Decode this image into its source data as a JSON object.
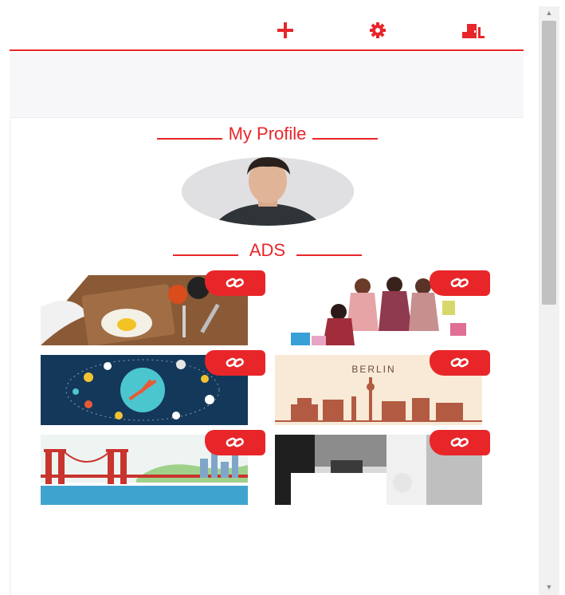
{
  "toolbar": {
    "icons": [
      "plus-icon",
      "gear-icon",
      "logout-door-icon"
    ]
  },
  "profile": {
    "title": "My Profile"
  },
  "ads": {
    "title": "ADS",
    "items": [
      {
        "image": "food-breakfast-photo"
      },
      {
        "image": "shopping-women-photo"
      },
      {
        "image": "clock-illustration"
      },
      {
        "image": "berlin-skyline-illustration",
        "caption": "BERLIN"
      },
      {
        "image": "bridge-city-illustration"
      },
      {
        "image": "interior-photo"
      }
    ]
  },
  "colors": {
    "accent": "#e8262a",
    "scrollbar_track": "#f1f1f1",
    "scrollbar_thumb": "#c1c1c1"
  }
}
